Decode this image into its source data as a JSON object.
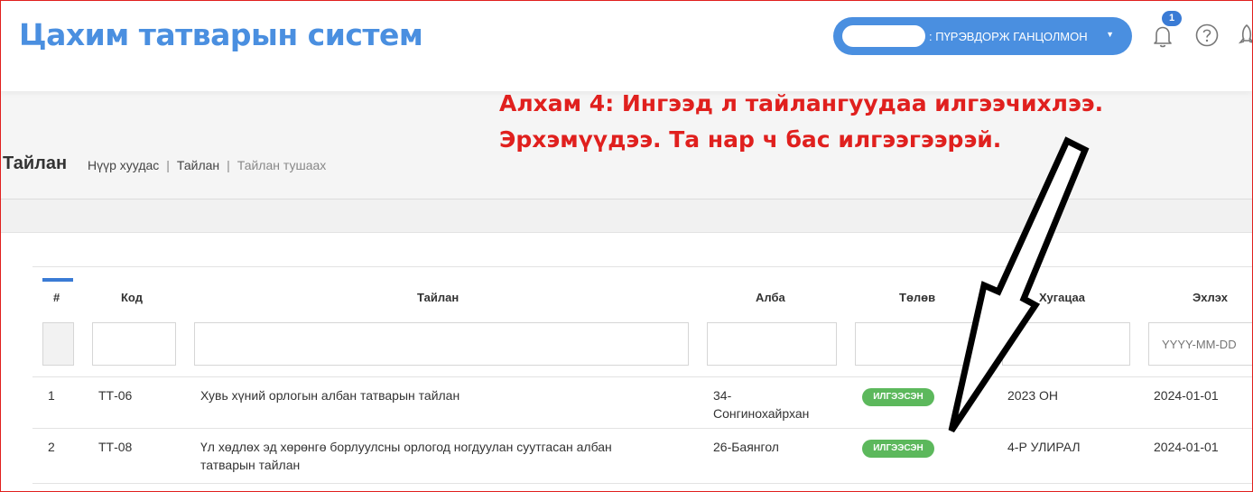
{
  "header": {
    "app_title": "Цахим татварын систем",
    "user_name": ": ПҮРЭВДОРЖ ГАНЦОЛМОН",
    "notification_count": "1"
  },
  "page": {
    "title": "Тайлан",
    "breadcrumb": [
      "Нүүр хуудас",
      "Тайлан",
      "Тайлан тушаах"
    ]
  },
  "annotation": {
    "line1": "Алхам 4: Ингээд л тайлангуудаа илгээчихлээ.",
    "line2": "Эрхэмүүдээ. Та нар ч бас илгээгээрэй."
  },
  "table": {
    "columns": [
      "#",
      "Код",
      "Тайлан",
      "Алба",
      "Төлөв",
      "Хугацаа",
      "Эхлэх"
    ],
    "date_placeholder": "YYYY-MM-DD",
    "rows": [
      {
        "num": "1",
        "code": "ТТ-06",
        "report": "Хувь хүний орлогын албан татварын тайлан",
        "office_l1": "34-",
        "office_l2": "Сонгинохайрхан",
        "status": "ИЛГЭЭСЭН",
        "period": "2023 ОН",
        "start": "2024-01-01"
      },
      {
        "num": "2",
        "code": "ТТ-08",
        "report_l1": "Үл хөдлөх эд хөрөнгө борлуулсны орлогод ногдуулан суутгасан албан",
        "report_l2": "татварын тайлан",
        "office": "26-Баянгол",
        "status": "ИЛГЭЭСЭН",
        "period": "4-Р УЛИРАЛ",
        "start": "2024-01-01"
      }
    ]
  },
  "colors": {
    "brand": "#4a8fe0",
    "status_sent": "#5cb85c",
    "annotation": "#e0201e"
  }
}
